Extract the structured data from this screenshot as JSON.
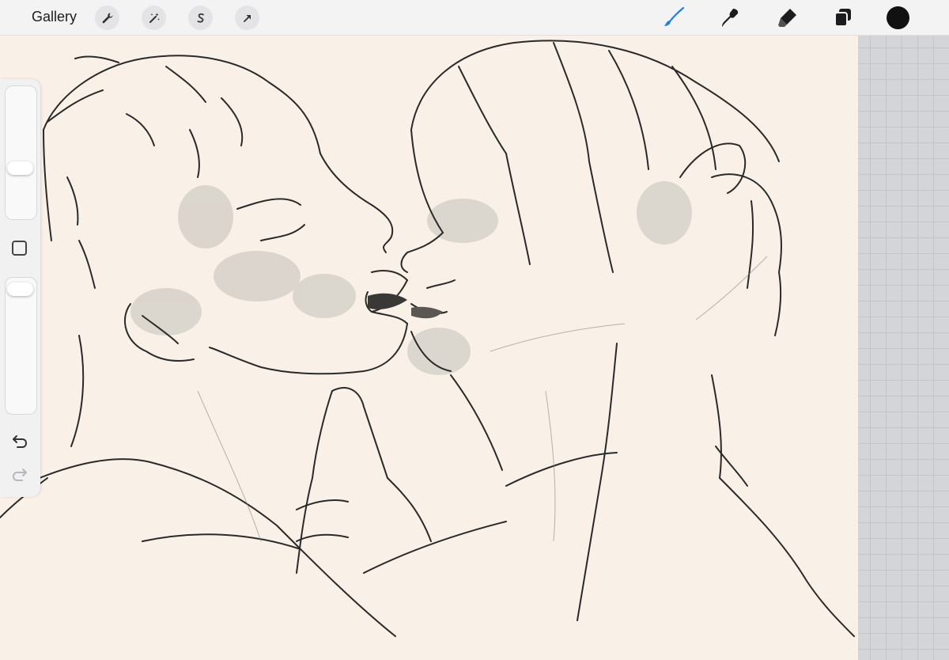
{
  "toolbar": {
    "gallery_label": "Gallery",
    "left_tools": [
      {
        "name": "wrench-icon"
      },
      {
        "name": "magic-wand-icon"
      },
      {
        "name": "selection-s-icon"
      },
      {
        "name": "transform-arrow-icon"
      }
    ],
    "right_tools": [
      {
        "name": "brush-icon",
        "active": true
      },
      {
        "name": "smudge-icon",
        "active": false
      },
      {
        "name": "eraser-icon",
        "active": false
      },
      {
        "name": "layers-icon",
        "active": false
      }
    ],
    "current_color": "#111111",
    "accent_color": "#1a84e6"
  },
  "sidebar": {
    "brush_size_slider": {
      "value": 0.55
    },
    "opacity_slider": {
      "value": 0.0
    },
    "modify_button": "square-icon",
    "undo": "undo-icon",
    "redo": "redo-icon"
  },
  "canvas": {
    "background_color": "#f9f1e7",
    "content": "line-art-sketch"
  }
}
